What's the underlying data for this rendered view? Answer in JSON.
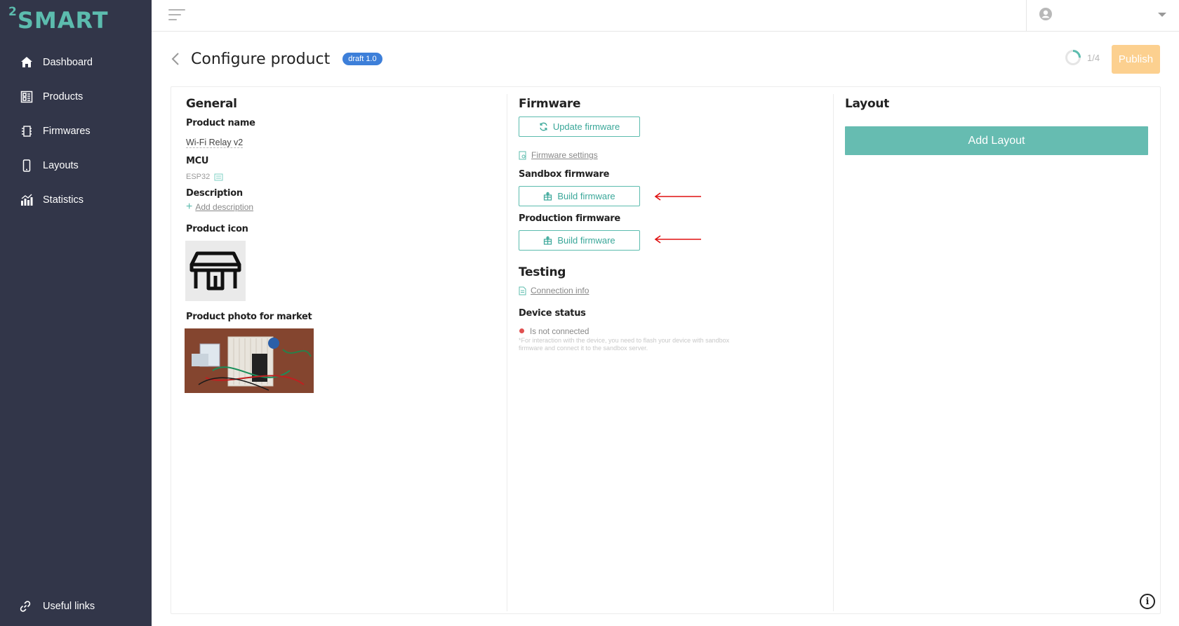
{
  "app": {
    "logo_text": "SMART",
    "logo_sup": "2"
  },
  "sidebar": {
    "items": [
      {
        "label": "Dashboard",
        "icon": "home-icon"
      },
      {
        "label": "Products",
        "icon": "products-icon"
      },
      {
        "label": "Firmwares",
        "icon": "firmware-icon"
      },
      {
        "label": "Layouts",
        "icon": "phone-icon"
      },
      {
        "label": "Statistics",
        "icon": "statistics-icon"
      }
    ],
    "useful_links": "Useful links"
  },
  "header": {
    "title": "Configure product",
    "badge": "draft 1.0",
    "progress": "1/4",
    "progress_fraction": 0.25,
    "publish": "Publish"
  },
  "general": {
    "title": "General",
    "product_name_label": "Product name",
    "product_name": "Wi-Fi Relay v2",
    "mcu_label": "MCU",
    "mcu": "ESP32",
    "description_label": "Description",
    "add_description": "Add description",
    "product_icon_label": "Product icon",
    "photo_label": "Product photo for market"
  },
  "firmware": {
    "title": "Firmware",
    "update_button": "Update firmware",
    "settings_link": "Firmware settings",
    "sandbox_label": "Sandbox firmware",
    "sandbox_build": "Build firmware",
    "production_label": "Production firmware",
    "production_build": "Build firmware",
    "testing_title": "Testing",
    "connection_info": "Connection info",
    "device_status_label": "Device status",
    "device_status": "Is not connected",
    "note": "*For interaction with the device, you need to flash your device with sandbox firmware and connect it to the sandbox server."
  },
  "layout": {
    "title": "Layout",
    "add_button": "Add Layout"
  },
  "colors": {
    "sidebar_bg": "#323649",
    "accent": "#5cbcae",
    "badge": "#3d7fd9",
    "publish": "#fcd08f",
    "arrow": "#e01010"
  }
}
